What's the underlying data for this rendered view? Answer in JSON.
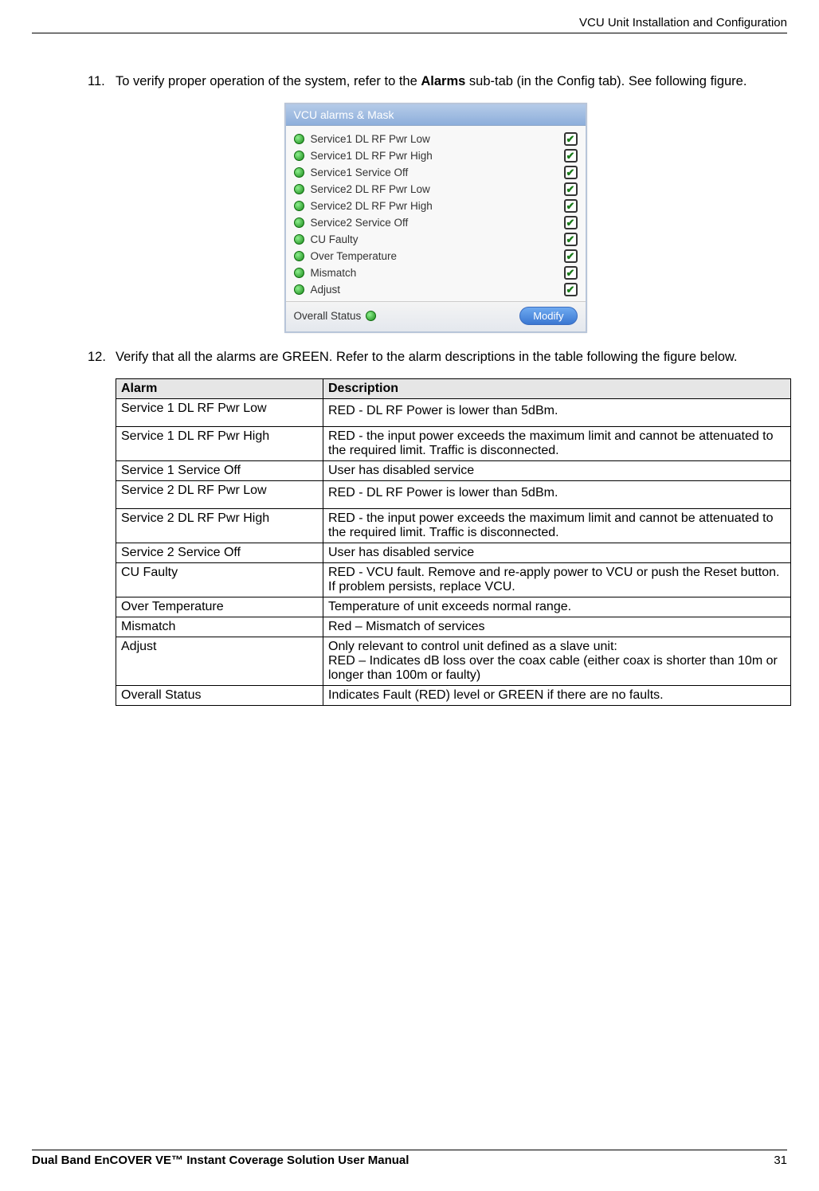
{
  "header": {
    "chapter": "VCU Unit Installation and Configuration"
  },
  "para1": {
    "number": "11.",
    "text_prefix": "To verify proper operation of the system, refer to the ",
    "bold": "Alarms",
    "text_suffix": " sub-tab (in the Config tab). See following figure."
  },
  "panel": {
    "title": "VCU alarms & Mask",
    "items": [
      "Service1 DL RF Pwr Low",
      "Service1 DL RF Pwr High",
      "Service1 Service Off",
      "Service2 DL RF Pwr Low",
      "Service2 DL RF Pwr High",
      "Service2 Service Off",
      "CU Faulty",
      "Over Temperature",
      "Mismatch",
      "Adjust"
    ],
    "overall_label": "Overall Status",
    "modify_label": "Modify",
    "check_glyph": "✔"
  },
  "para2": {
    "number": "12.",
    "text": "Verify that all the alarms are GREEN. Refer to the alarm descriptions in the table following the figure below."
  },
  "table": {
    "head_alarm": "Alarm",
    "head_desc": "Description",
    "rows": [
      {
        "alarm": "Service 1 DL RF Pwr Low",
        "desc": "RED - DL RF Power is lower than 5dBm.",
        "justify": false,
        "pad": true
      },
      {
        "alarm": "Service 1 DL RF Pwr High",
        "desc": "RED - the input power exceeds the maximum limit and cannot be attenuated to the required limit. Traffic is disconnected.",
        "justify": true,
        "pad": false
      },
      {
        "alarm": "Service 1 Service Off",
        "desc": "User has disabled service",
        "justify": false,
        "pad": false
      },
      {
        "alarm": "Service 2 DL RF Pwr Low",
        "desc": "RED - DL RF Power is lower than 5dBm.",
        "justify": false,
        "pad": true
      },
      {
        "alarm": "Service 2 DL RF Pwr High",
        "desc": "RED - the input power exceeds the maximum limit and cannot be attenuated to the required limit. Traffic is disconnected.",
        "justify": true,
        "pad": false
      },
      {
        "alarm": "Service 2 Service Off",
        "desc": "User has disabled service",
        "justify": false,
        "pad": false
      },
      {
        "alarm": "CU Faulty",
        "desc": "RED - VCU fault. Remove and re-apply power to VCU or push the Reset button. If problem persists, replace VCU.",
        "justify": true,
        "pad": false
      },
      {
        "alarm": "Over Temperature",
        "desc": "Temperature of unit exceeds normal range.",
        "justify": false,
        "pad": false
      },
      {
        "alarm": "Mismatch",
        "desc": "Red – Mismatch of services",
        "justify": false,
        "pad": false
      },
      {
        "alarm": "Adjust",
        "desc": "Only relevant to control unit defined as a slave unit:\nRED – Indicates dB loss over the coax  cable (either coax is shorter than 10m or longer than 100m or faulty)",
        "justify": false,
        "pad": false
      },
      {
        "alarm": "Overall Status",
        "desc": "Indicates Fault (RED) level or GREEN if there are no faults.",
        "justify": false,
        "pad": false
      }
    ]
  },
  "footer": {
    "title": "Dual Band EnCOVER VE™ Instant Coverage Solution User Manual",
    "page": "31"
  }
}
